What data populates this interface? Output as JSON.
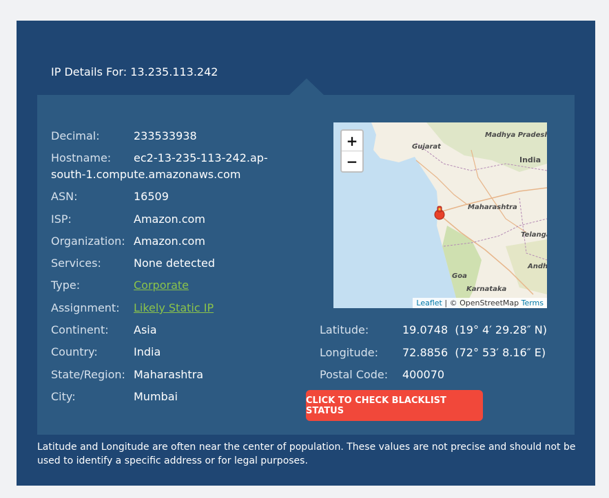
{
  "heading": "IP Details For: 13.235.113.242",
  "details": [
    {
      "label": "Decimal:",
      "value": "233533938"
    },
    {
      "label": "Hostname:",
      "value_line1": "ec2-13-235-113-242.ap-",
      "value_line2": "south-1.compute.amazonaws.com"
    },
    {
      "label": "ASN:",
      "value": "16509"
    },
    {
      "label": "ISP:",
      "value": "Amazon.com"
    },
    {
      "label": "Organization:",
      "value": "Amazon.com"
    },
    {
      "label": "Services:",
      "value": "None detected"
    },
    {
      "label": "Type:",
      "value": "Corporate"
    },
    {
      "label": "Assignment:",
      "value": "Likely Static IP"
    },
    {
      "label": "Continent:",
      "value": "Asia"
    },
    {
      "label": "Country:",
      "value": "India"
    },
    {
      "label": "State/Region:",
      "value": "Maharashtra"
    },
    {
      "label": "City:",
      "value": "Mumbai"
    }
  ],
  "geo": [
    {
      "label": "Latitude:",
      "value": "19.0748  (19° 4′ 29.28″ N)"
    },
    {
      "label": "Longitude:",
      "value": "72.8856  (72° 53′ 8.16″ E)"
    },
    {
      "label": "Postal Code:",
      "value": "400070"
    }
  ],
  "map": {
    "zoom_in": "+",
    "zoom_out": "−",
    "attribution_leaflet": "Leaflet",
    "attribution_osm": "| © OpenStreetMap",
    "attribution_terms": "Terms",
    "labels": [
      "Gujarat",
      "Madhya Pradesh",
      "India",
      "Maharashtra",
      "Telangana",
      "Andhra",
      "Goa",
      "Karnataka"
    ],
    "sea_color": "#c4dff2",
    "land_color": "#f3efe4",
    "marker_color": "#e8412a"
  },
  "button": "CLICK TO CHECK BLACKLIST STATUS",
  "note": "Latitude and Longitude are often near the center of population. These values are not precise and should not be used to identify a specific address or for legal purposes."
}
